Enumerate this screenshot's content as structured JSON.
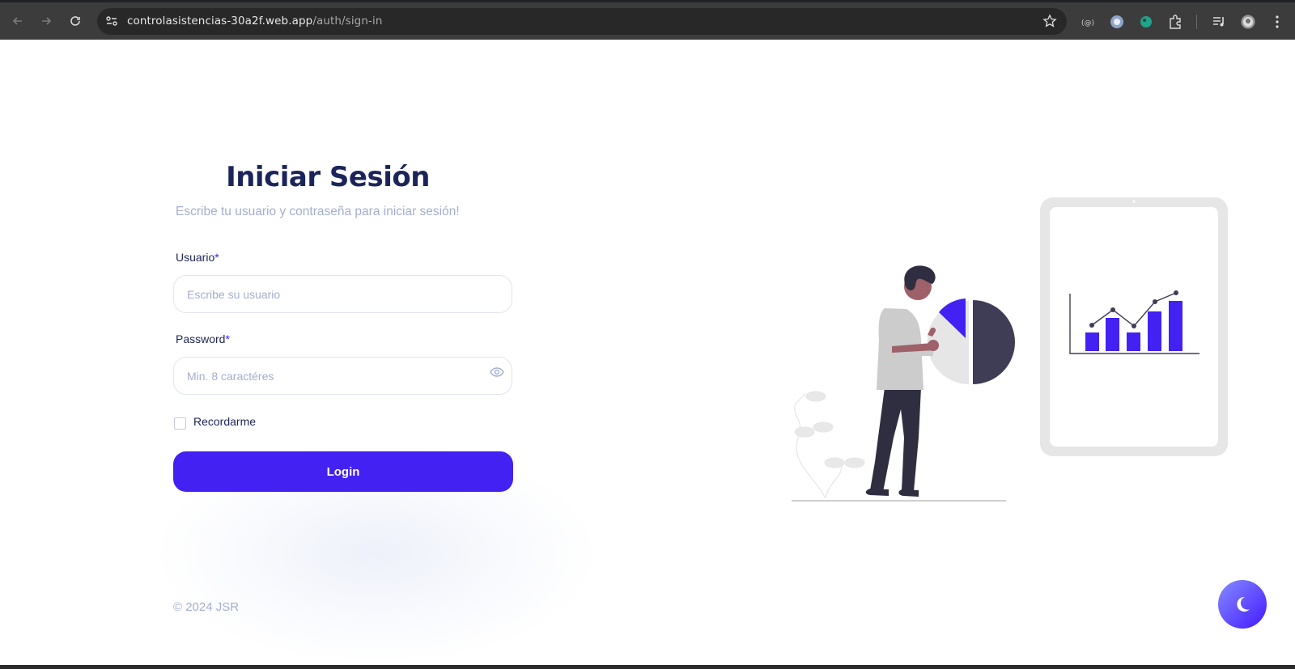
{
  "browser": {
    "url_host": "controlasistencias-30a2f.web.app",
    "url_path": "/auth/sign-in"
  },
  "login": {
    "title": "Iniciar Sesión",
    "subtitle": "Escribe tu usuario y contraseña para iniciar sesión!",
    "username_label": "Usuario",
    "username_required": "*",
    "username_placeholder": "Escribe su usuario",
    "password_label": "Password",
    "password_required": "*",
    "password_placeholder": "Min. 8 caractéres",
    "remember_label": "Recordarme",
    "login_button": "Login"
  },
  "footer": {
    "copyright": "© 2024 JSR"
  },
  "colors": {
    "brand": "#4221f2",
    "heading": "#1b2559",
    "muted": "#a3aed0"
  }
}
